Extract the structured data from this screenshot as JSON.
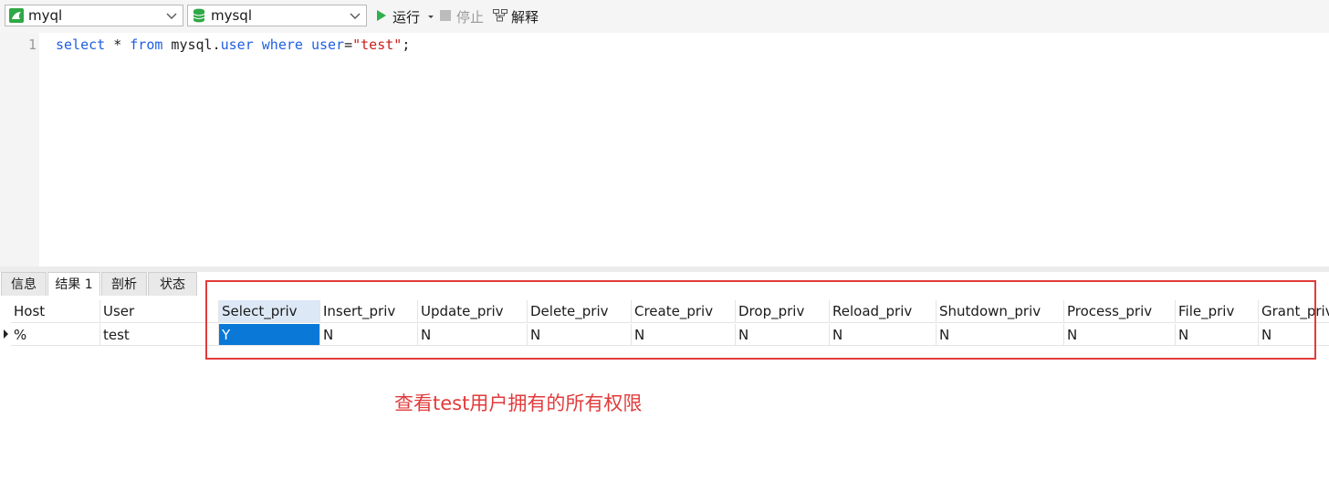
{
  "toolbar": {
    "connection": "myql",
    "database": "mysql",
    "run_label": "运行",
    "stop_label": "停止",
    "explain_label": "解释",
    "colors": {
      "run": "#2fb04a",
      "connection_icon": "#2fa846",
      "db_icon": "#2fa846"
    }
  },
  "editor": {
    "line_number": "1",
    "code_tokens": {
      "t1": "select",
      "t2": " * ",
      "t3": "from",
      "t4": " mysql",
      "t5": ".",
      "t6": "user",
      "t7": " ",
      "t8": "where",
      "t9": " ",
      "t10": "user",
      "t11": "=",
      "t12": "\"test\"",
      "t13": ";"
    }
  },
  "tabs": [
    {
      "label": "信息"
    },
    {
      "label": "结果 1"
    },
    {
      "label": "剖析"
    },
    {
      "label": "状态"
    }
  ],
  "grid": {
    "columns": [
      "Host",
      "User",
      "Select_priv",
      "Insert_priv",
      "Update_priv",
      "Delete_priv",
      "Create_priv",
      "Drop_priv",
      "Reload_priv",
      "Shutdown_priv",
      "Process_priv",
      "File_priv",
      "Grant_priv"
    ],
    "row": [
      "%",
      "test",
      "Y",
      "N",
      "N",
      "N",
      "N",
      "N",
      "N",
      "N",
      "N",
      "N",
      "N"
    ]
  },
  "annotation": "查看test用户拥有的所有权限"
}
